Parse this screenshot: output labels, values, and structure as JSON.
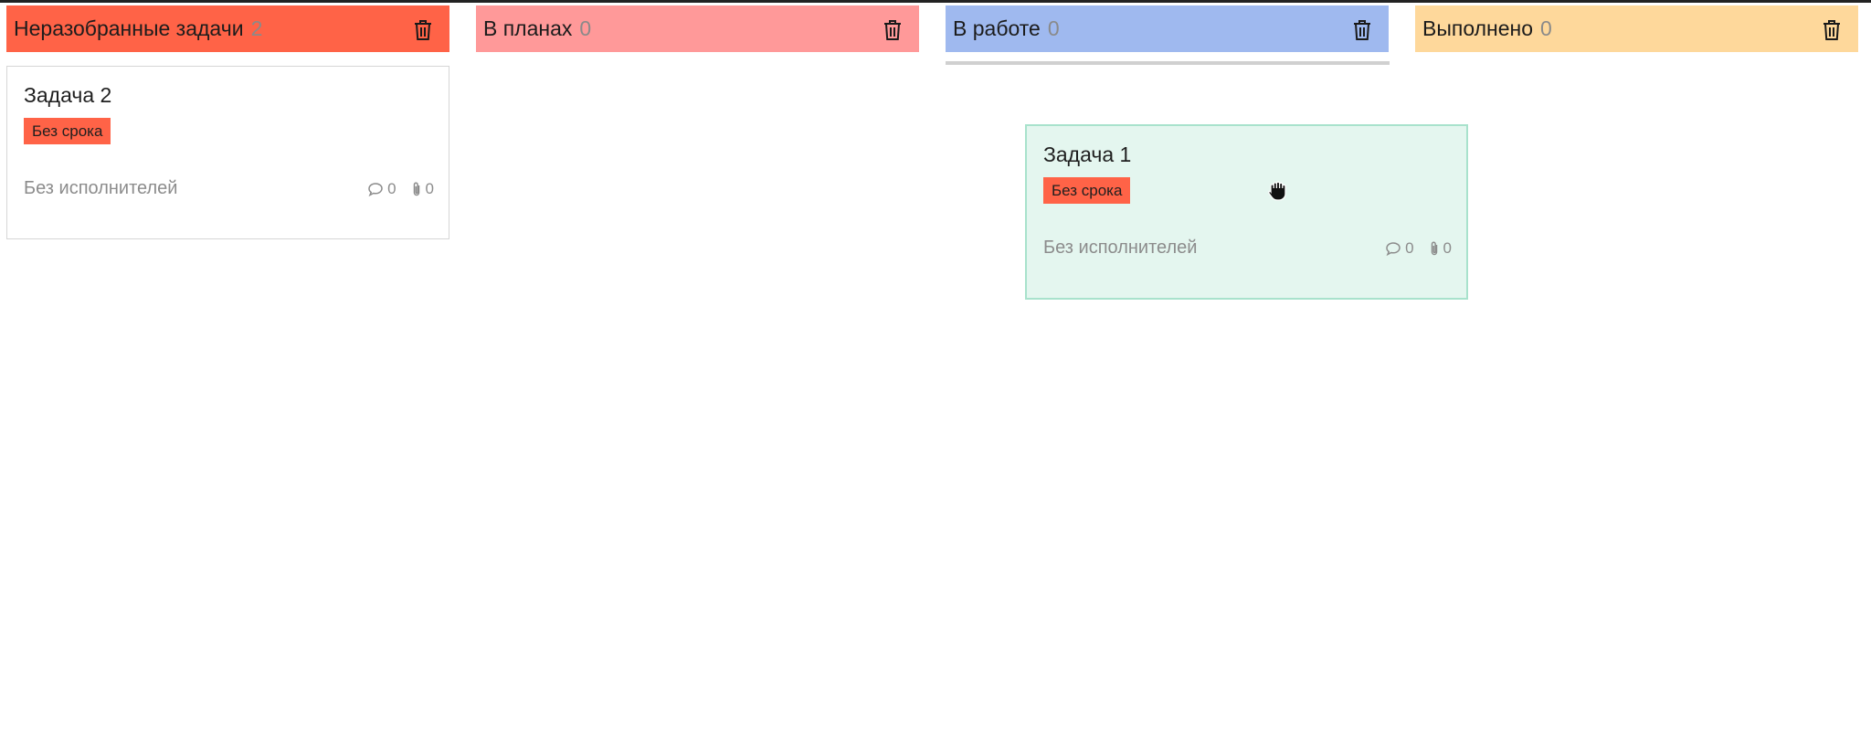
{
  "colors": {
    "unsorted": "#ff6347",
    "planned": "#ff9999",
    "in_progress": "#9fb9ef",
    "done": "#fed89b",
    "due_badge": "#ff6347",
    "dragging_card_bg": "#e4f6ef",
    "dragging_card_border": "#a8e2cc"
  },
  "columns": [
    {
      "title": "Неразобранные задачи",
      "count": "2",
      "color": "#ff6347"
    },
    {
      "title": "В планах",
      "count": "0",
      "color": "#ff9999"
    },
    {
      "title": "В работе",
      "count": "0",
      "color": "#9fb9ef"
    },
    {
      "title": "Выполнено",
      "count": "0",
      "color": "#fed89b"
    }
  ],
  "cards": [
    {
      "title": "Задача 2",
      "due": "Без срока",
      "assignee": "Без исполнителей",
      "comments": "0",
      "attachments": "0"
    },
    {
      "title": "Задача 1",
      "due": "Без срока",
      "assignee": "Без исполнителей",
      "comments": "0",
      "attachments": "0",
      "state": "dragging"
    }
  ],
  "icons": {
    "column_delete": "trash-icon",
    "comments": "comment-bubble-icon",
    "attachments": "paperclip-icon",
    "cursor": "grab-hand-cursor-icon"
  }
}
